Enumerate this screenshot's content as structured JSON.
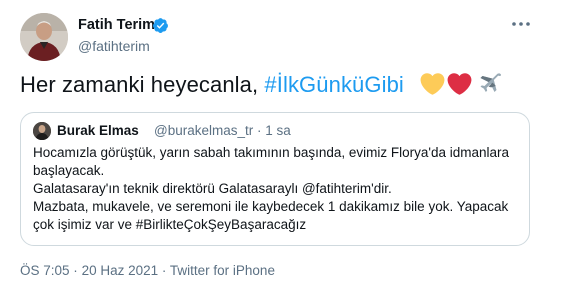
{
  "author": {
    "name": "Fatih Terim",
    "handle": "@fatihterim"
  },
  "tweet": {
    "text": "Her zamanki heyecanla, ",
    "hashtag": "#İlkGünküGibi",
    "emojis": [
      "yellow-heart-icon",
      "red-heart-icon",
      "airplane-icon"
    ]
  },
  "quote": {
    "name": "Burak Elmas",
    "handle": "@burakelmas_tr",
    "separator": "·",
    "time": "1 sa",
    "lines": [
      "Hocamızla görüştük, yarın sabah takımının başında, evimiz Florya'da idmanlara başlayacak.",
      "Galatasaray'ın teknik direktörü Galatasaraylı @fatihterim'dir.",
      "Mazbata, mukavele, ve seremoni ile kaybedecek 1 dakikamız bile yok. Yapacak çok işimiz var ve #BirlikteÇokŞeyBaşaracağız"
    ]
  },
  "meta": {
    "time": "ÖS 7:05",
    "separator": "·",
    "date": "20 Haz 2021",
    "source": "Twitter for iPhone"
  },
  "colors": {
    "accent": "#1d9bf0",
    "secondary_text": "#5b7083",
    "border": "#cfd9de"
  }
}
